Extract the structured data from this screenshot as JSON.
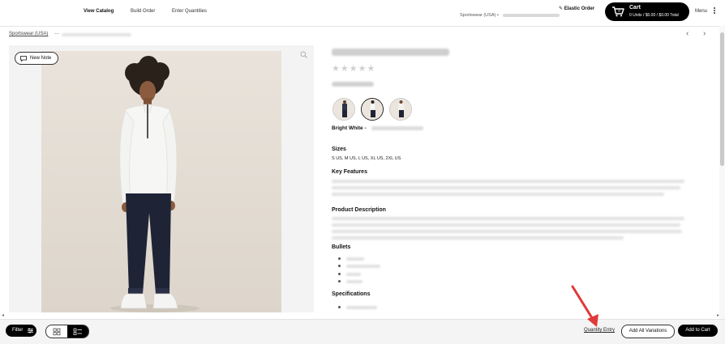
{
  "header": {
    "nav": [
      "View Catalog",
      "Build Order",
      "Enter Quantities"
    ],
    "store_label": "Sportswear (USA) •",
    "elastic_label": "Elastic Order",
    "cart_title": "Cart",
    "cart_summary": "0 Units / $0.00 / $0.00 Total",
    "cart_count": "0",
    "menu_label": "Menu"
  },
  "breadcrumb": {
    "root": "Sportswear (USA)",
    "sep": "—"
  },
  "image_panel": {
    "new_note_label": "New Note"
  },
  "product": {
    "stars": "★★★★★",
    "color_name": "Bright White -",
    "sections": {
      "sizes": "Sizes",
      "key_features": "Key Features",
      "description": "Product Description",
      "bullets": "Bullets",
      "specs": "Specifications"
    },
    "sizes_value": "S US, M US, L US, XL US, 2XL US"
  },
  "footer": {
    "filter_label": "Filter",
    "quantity_entry": "Quantity Entry",
    "add_all": "Add All Variations",
    "add_to_cart": "Add to Cart"
  },
  "colors": {
    "accent": "#000000",
    "annotation_arrow": "#e03a3a"
  }
}
